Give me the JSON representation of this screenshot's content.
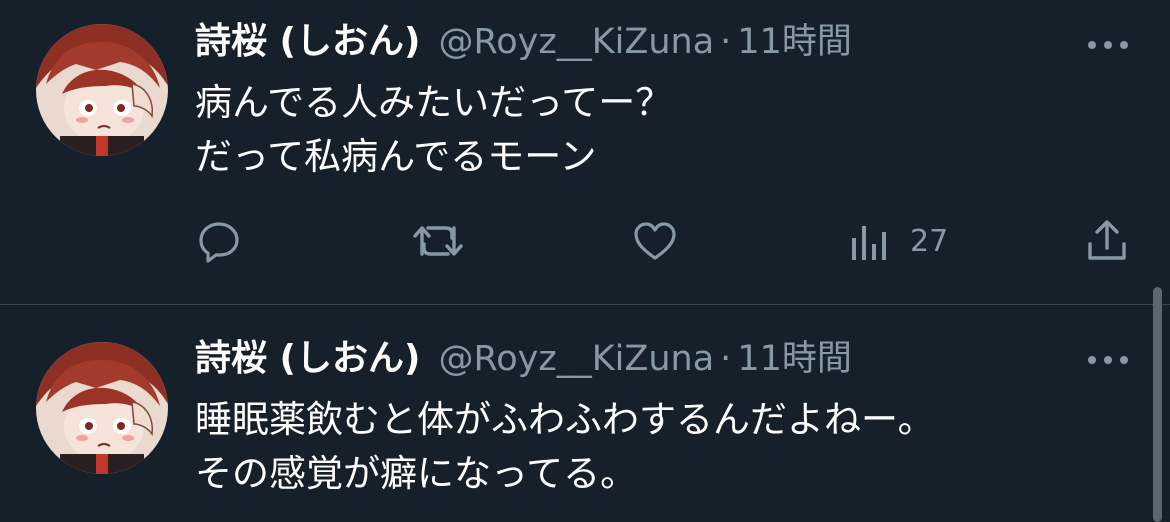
{
  "tweets": [
    {
      "display_name": "詩桜 (しおん)",
      "handle": "@Royz__KiZuna",
      "separator": "·",
      "time": "11時間",
      "text_lines": [
        "病んでる人みたいだってー？",
        "だって私病んでるモーン"
      ],
      "actions": {
        "reply_icon": "reply-icon",
        "retweet_icon": "retweet-icon",
        "like_icon": "heart-icon",
        "views_icon": "views-icon",
        "views_count": "27",
        "share_icon": "share-icon"
      }
    },
    {
      "display_name": "詩桜 (しおん)",
      "handle": "@Royz__KiZuna",
      "separator": "·",
      "time": "11時間",
      "text_lines": [
        "睡眠薬飲むと体がふわふわするんだよねー。",
        "その感覚が癖になってる。"
      ]
    }
  ],
  "colors": {
    "background": "#15202b",
    "primary_text": "#ffffff",
    "secondary_text": "#8899a6",
    "divider": "#38444d"
  }
}
